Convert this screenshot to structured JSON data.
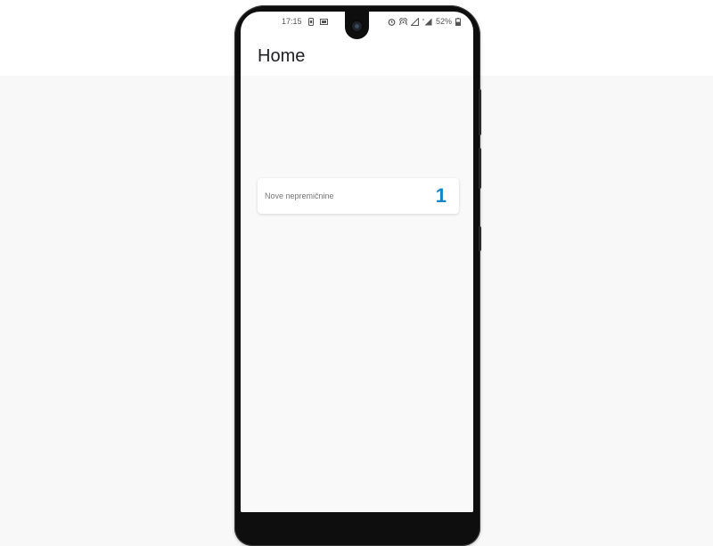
{
  "status_bar": {
    "time": "17:15",
    "battery_percent": "52%",
    "left_icons": [
      "sim-card-icon",
      "gallery-icon"
    ],
    "right_icons": [
      "alarm-icon",
      "hotspot-icon",
      "signal-icon",
      "signal-nodata-icon",
      "battery-icon"
    ]
  },
  "header": {
    "title": "Home"
  },
  "cards": [
    {
      "label": "Nove nepremičnine",
      "value": "1"
    }
  ],
  "colors": {
    "accent": "#1486c6",
    "background": "#f9f9f9",
    "card": "#ffffff",
    "title_text": "#202124"
  }
}
